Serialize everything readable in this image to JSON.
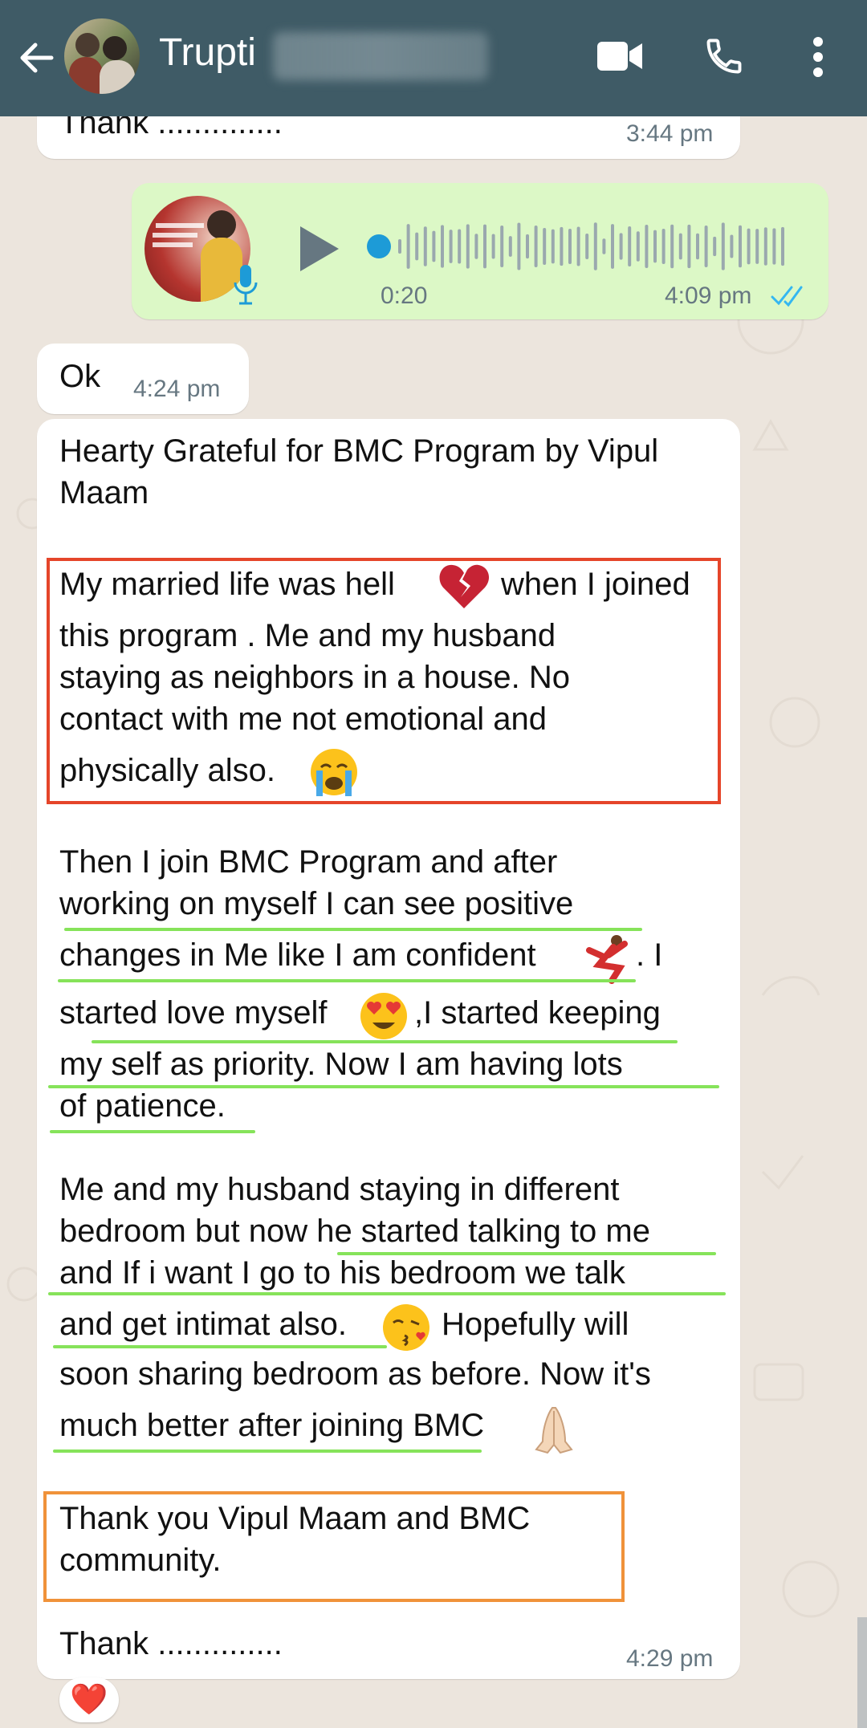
{
  "header": {
    "contact_name": "Trupti",
    "icons": [
      "back-arrow-icon",
      "video-call-icon",
      "voice-call-icon",
      "more-vert-icon"
    ]
  },
  "messages": {
    "prev_tail": {
      "text": "Thank ..............",
      "time": "3:44 pm"
    },
    "voice": {
      "duration": "0:20",
      "time": "4:09 pm",
      "status": "read"
    },
    "ok": {
      "text": "Ok",
      "time": "4:24 pm"
    },
    "long": {
      "heading_lines": [
        "Hearty Grateful for BMC Program by Vipul",
        "Maam"
      ],
      "p1_lines": [
        "My married life was hell",
        "when I joined",
        "this program . Me and my husband",
        "staying as neighbors in a house. No",
        "contact with me not emotional and",
        "physically also."
      ],
      "p2_lines": [
        "Then I join BMC Program and  after",
        "working on myself I can see positive",
        "changes in Me like I am confident",
        ". I",
        "started love myself",
        ",I started keeping",
        "my self as priority. Now I am having lots",
        "of patience."
      ],
      "p3_lines": [
        "Me and my husband staying in different",
        "bedroom but now he started talking to me",
        "and If i want I go to his bedroom we talk",
        "and get intimat also.",
        "Hopefully will",
        "soon sharing bedroom as before. Now it's",
        "much better after joining BMC"
      ],
      "p4_lines": [
        "Thank you Vipul Maam and BMC",
        "community."
      ],
      "closing": "Thank ..............",
      "time": "4:29 pm",
      "reaction": "❤️"
    }
  },
  "colors": {
    "header_bg": "#3f5b66",
    "chat_bg": "#ece5dd",
    "outgoing_bubble": "#dcf8c6",
    "incoming_bubble": "#ffffff",
    "read_ticks": "#34b7f1",
    "highlight_red": "#e5452a",
    "highlight_orange": "#f0923a",
    "underline_green": "#86e35a"
  }
}
